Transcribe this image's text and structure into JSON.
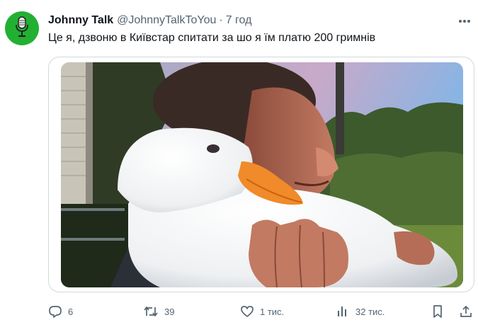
{
  "user": {
    "display_name": "Johnny Talk",
    "handle": "@JohnnyTalkToYou",
    "separator": "·",
    "time": "7 год",
    "avatar_icon": "microphone-icon",
    "avatar_color": "#22b033"
  },
  "tweet": {
    "text": "Це я, дзвоню в Київстар спитати за шо я їм платю 200 гримнів"
  },
  "media": {
    "type": "photo",
    "subject": "man-hugging-white-duck"
  },
  "actions": {
    "replies": {
      "icon": "reply-icon",
      "count": "6"
    },
    "retweets": {
      "icon": "retweet-icon",
      "count": "39"
    },
    "likes": {
      "icon": "heart-icon",
      "count": "1 тис."
    },
    "views": {
      "icon": "views-icon",
      "count": "32 тис."
    },
    "bookmark": {
      "icon": "bookmark-icon"
    },
    "share": {
      "icon": "share-icon"
    },
    "more": {
      "icon": "more-icon"
    }
  },
  "colors": {
    "text_primary": "#0f1419",
    "text_secondary": "#536471",
    "border": "#cfd9de"
  }
}
